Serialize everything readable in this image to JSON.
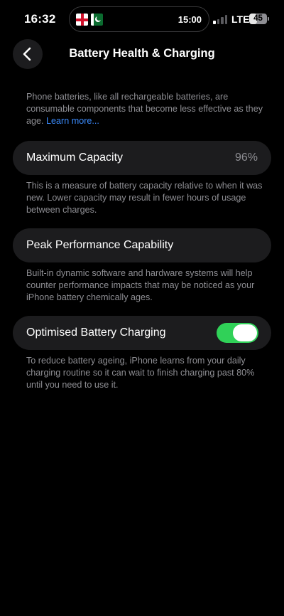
{
  "status_bar": {
    "time": "16:32",
    "island_time": "15:00",
    "network": "LTE",
    "battery_level": "45",
    "signal_bars_active": 1,
    "signal_bars_total": 4,
    "flags": [
      "england-flag-icon",
      "pakistan-flag-icon"
    ]
  },
  "nav": {
    "back_icon": "chevron-left-icon",
    "title": "Battery Health & Charging"
  },
  "intro": {
    "text": "Phone batteries, like all rechargeable batteries, are consumable components that become less effective as they age.",
    "link": "Learn more..."
  },
  "maximum_capacity": {
    "label": "Maximum Capacity",
    "value": "96%",
    "description": "This is a measure of battery capacity relative to when it was new. Lower capacity may result in fewer hours of usage between charges."
  },
  "peak_performance": {
    "label": "Peak Performance Capability",
    "description": "Built-in dynamic software and hardware systems will help counter performance impacts that may be noticed as your iPhone battery chemically ages."
  },
  "optimised_charging": {
    "label": "Optimised Battery Charging",
    "enabled": true,
    "description": "To reduce battery ageing, iPhone learns from your daily charging routine so it can wait to finish charging past 80% until you need to use it."
  },
  "colors": {
    "background": "#000000",
    "card": "#1c1c1e",
    "secondary_text": "#8e8e93",
    "link": "#3b8cff",
    "toggle_on": "#30d158"
  }
}
